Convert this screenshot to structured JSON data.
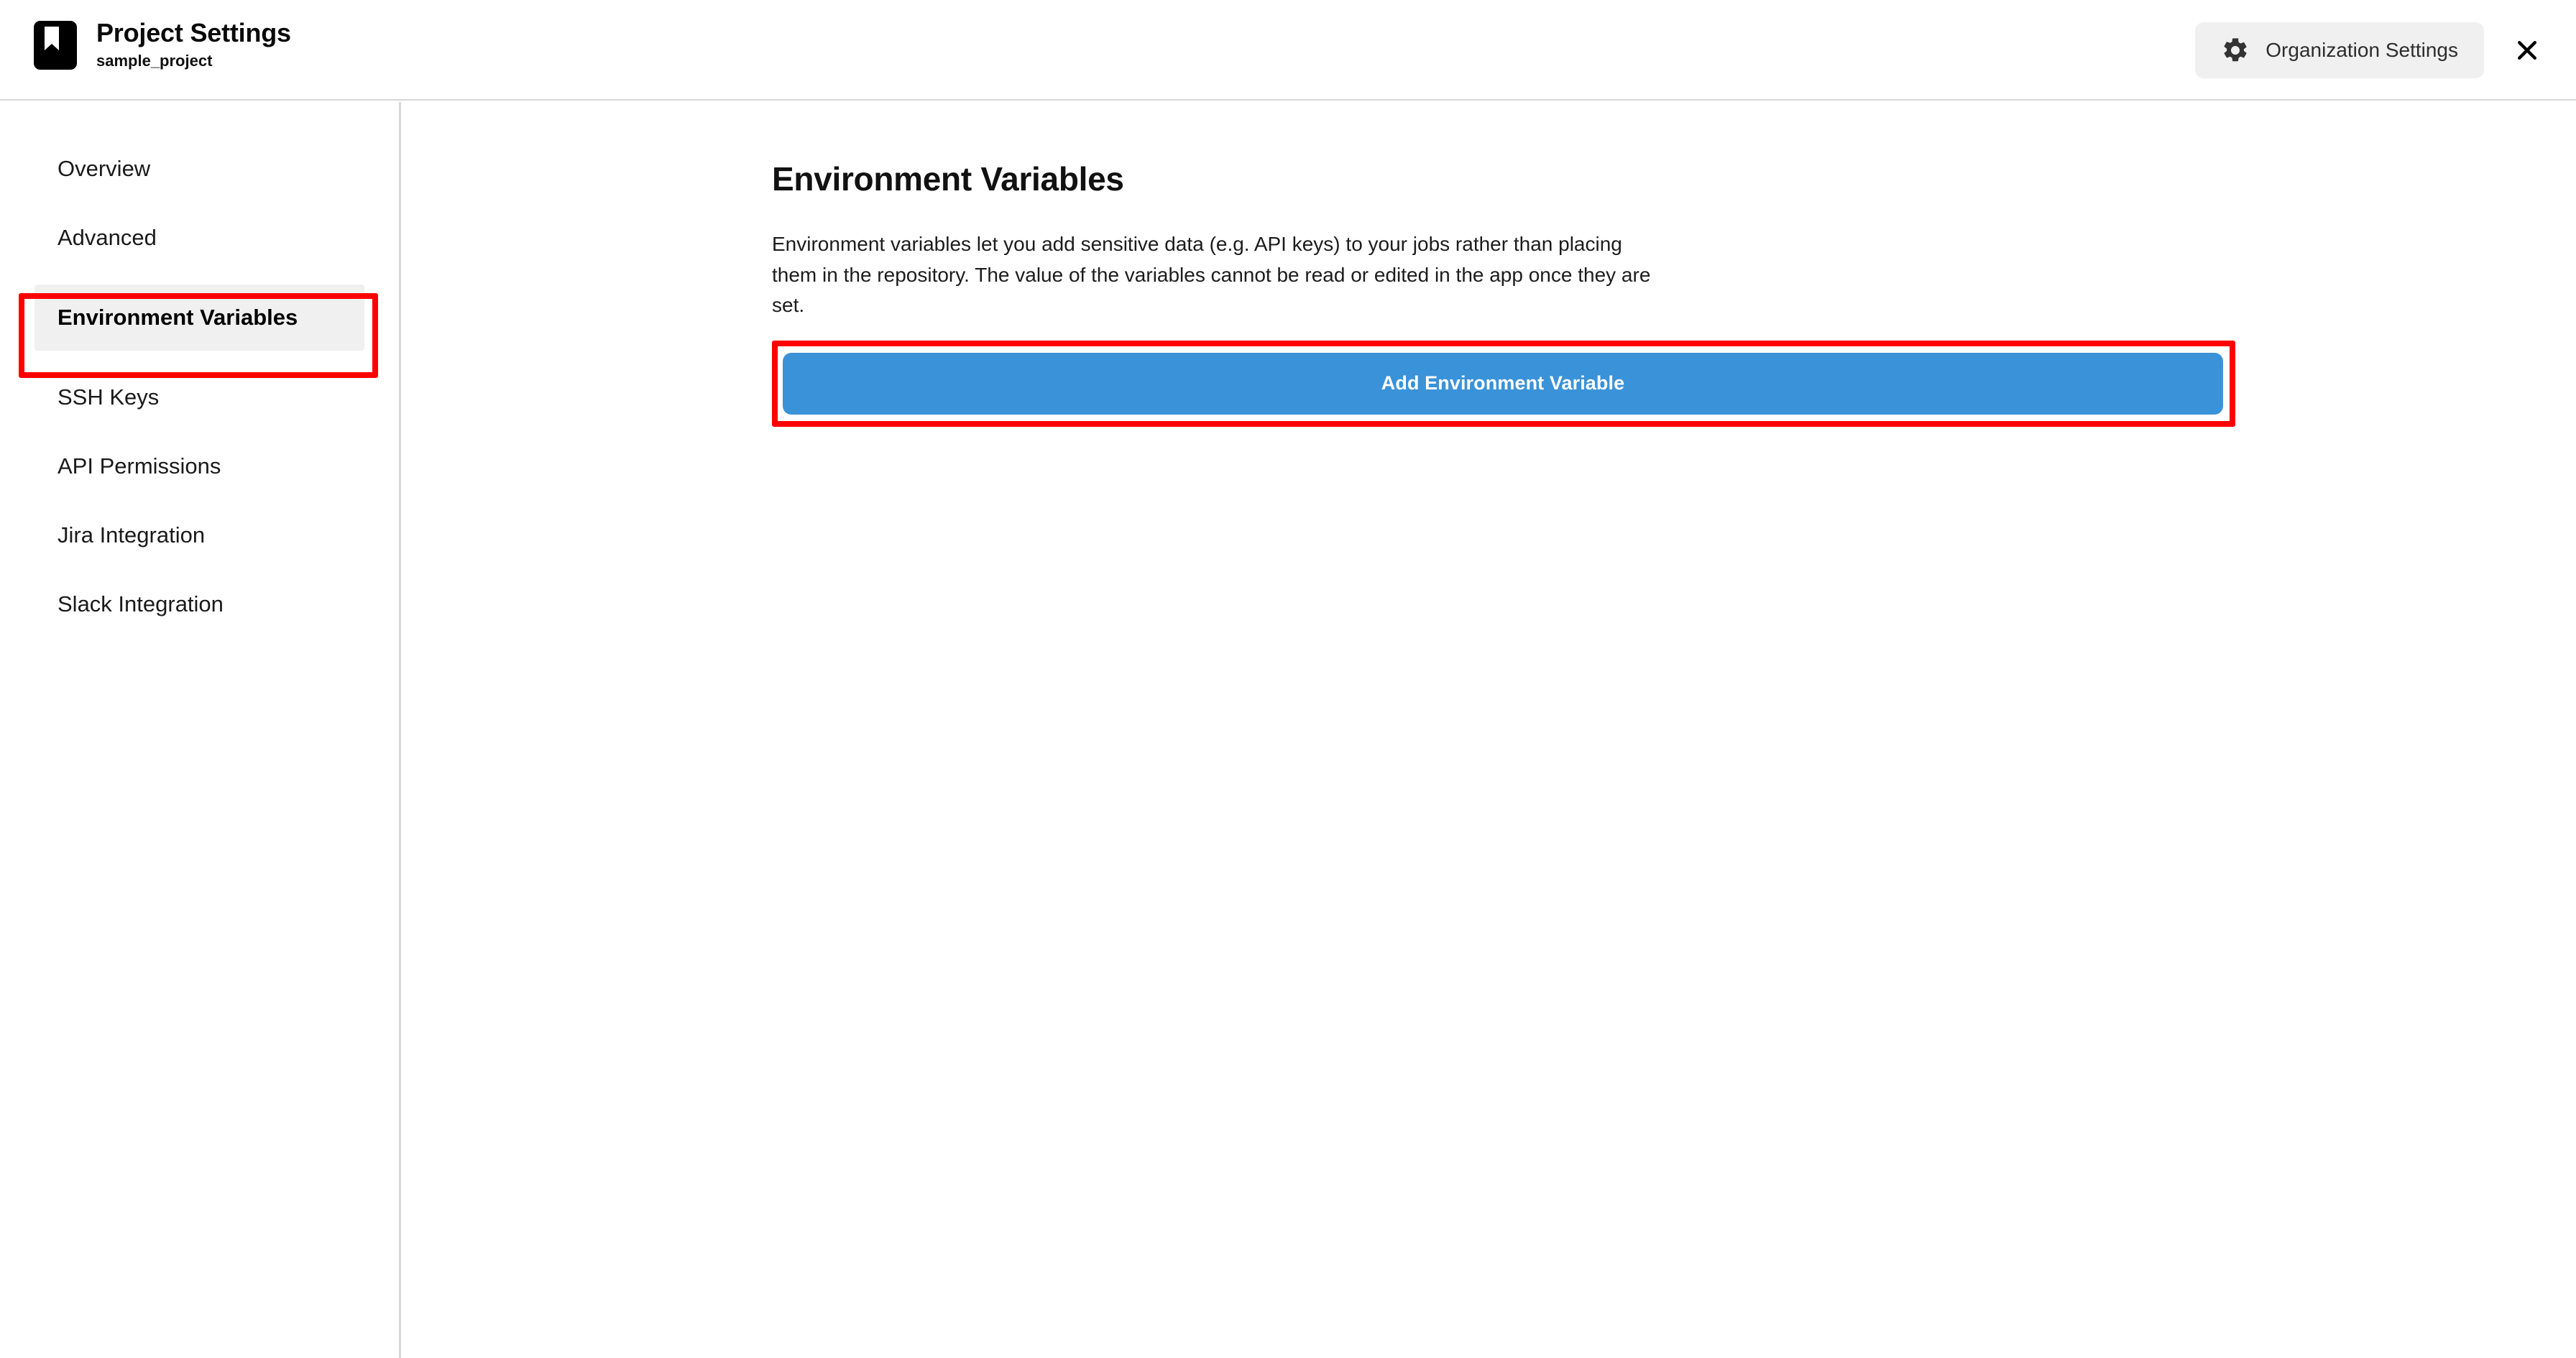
{
  "header": {
    "brand_icon": "bookmark-icon",
    "title": "Project Settings",
    "subtitle": "sample_project",
    "org_button": {
      "icon": "gear-icon",
      "label": "Organization Settings"
    },
    "close_button": {
      "icon": "close-icon",
      "label": "✕"
    }
  },
  "sidebar": {
    "items": [
      {
        "label": "Overview",
        "active": false
      },
      {
        "label": "Advanced",
        "active": false
      },
      {
        "label": "Environment Variables",
        "active": true
      },
      {
        "label": "SSH Keys",
        "active": false
      },
      {
        "label": "API Permissions",
        "active": false
      },
      {
        "label": "Jira Integration",
        "active": false
      },
      {
        "label": "Slack Integration",
        "active": false
      }
    ]
  },
  "main": {
    "page_title": "Environment Variables",
    "description": "Environment variables let you add sensitive data (e.g. API keys) to your jobs rather than placing them in the repository. The value of the variables cannot be read or edited in the app once they are set.",
    "add_button_label": "Add Environment Variable"
  },
  "colors": {
    "accent_blue": "#3a92d8",
    "annotation_red": "#ff0000",
    "active_nav_bg": "#f0f0f0",
    "org_button_bg": "#f0f0f0",
    "divider": "#d8d8d8"
  },
  "annotations": [
    {
      "target": "sidebar-item-environment-variables",
      "color": "#ff0000"
    },
    {
      "target": "add-environment-variable-button",
      "color": "#ff0000"
    }
  ]
}
